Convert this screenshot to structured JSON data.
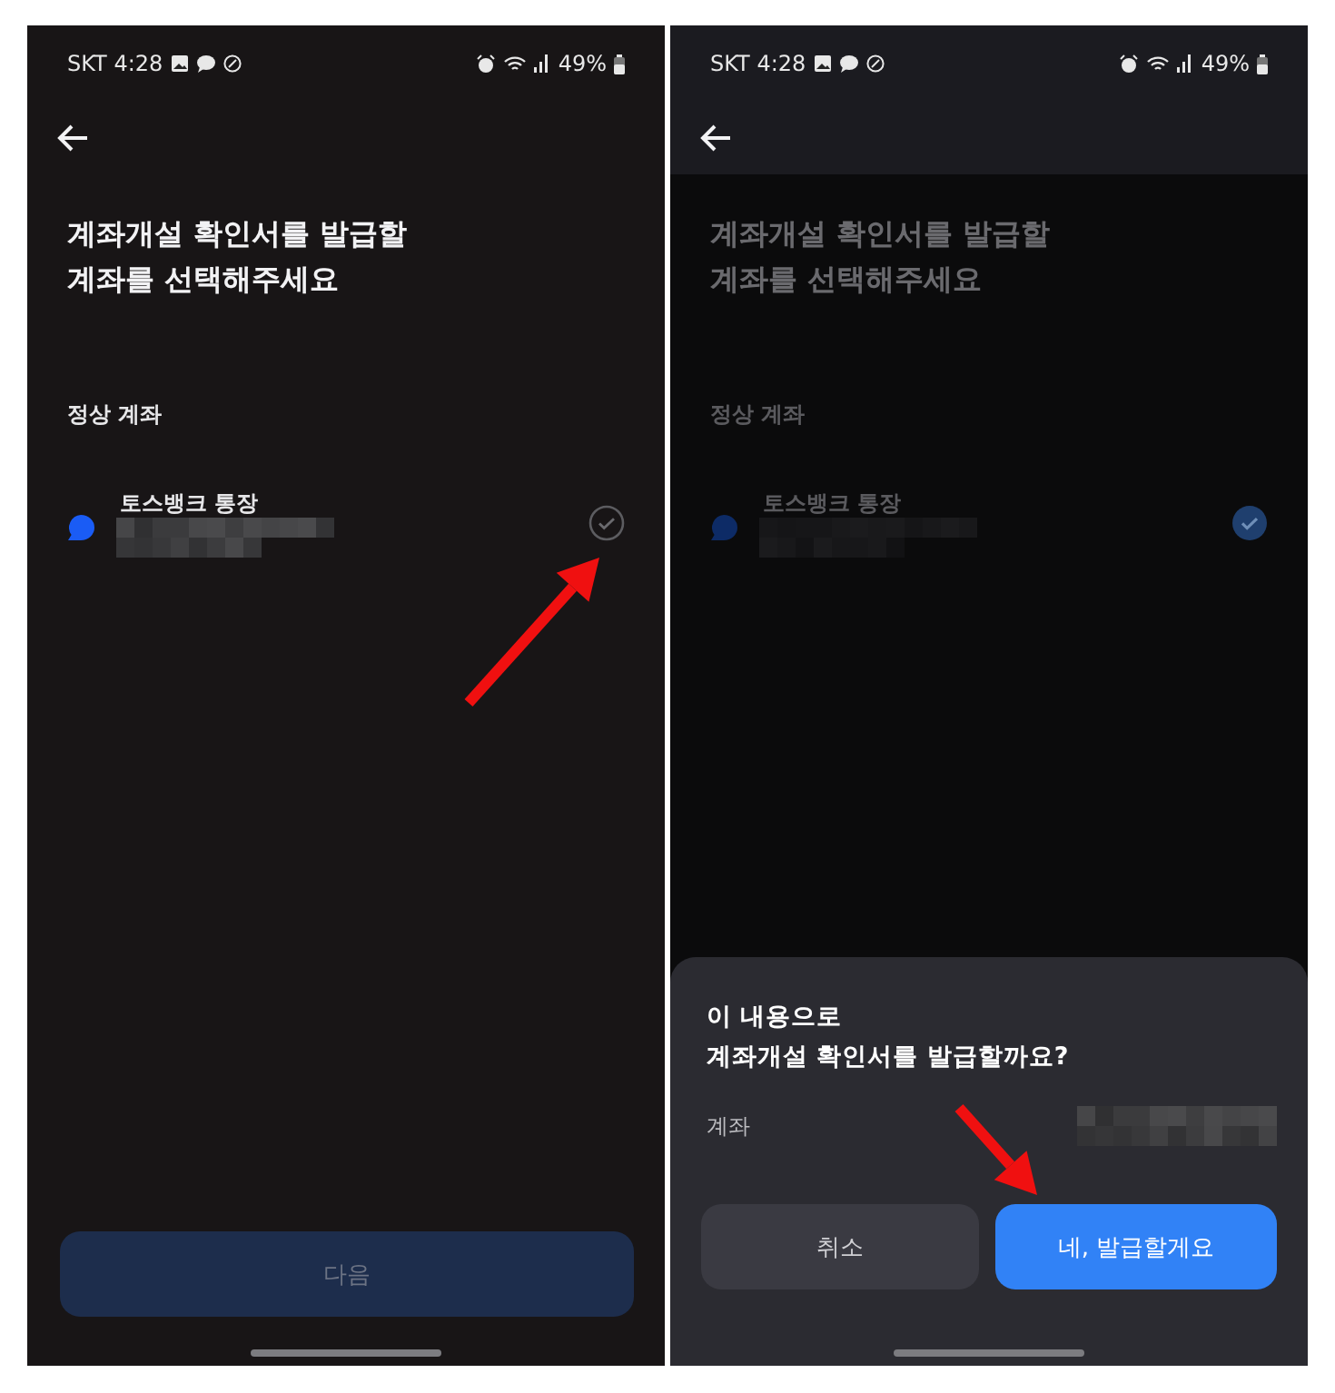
{
  "screens": [
    {
      "status_bar": {
        "carrier_time": "SKT 4:28",
        "battery": "49%"
      },
      "dimmed": false,
      "heading_lines": [
        "계좌개설 확인서를 발급할",
        "계좌를 선택해주세요"
      ],
      "section_label": "정상 계좌",
      "accounts": [
        {
          "name": "토스뱅크 통장",
          "selected": false
        }
      ],
      "next_button": {
        "label": "다음",
        "disabled": true
      }
    },
    {
      "status_bar": {
        "carrier_time": "SKT 4:28",
        "battery": "49%"
      },
      "dimmed": true,
      "heading_lines": [
        "계좌개설 확인서를 발급할",
        "계좌를 선택해주세요"
      ],
      "section_label": "정상 계좌",
      "accounts": [
        {
          "name": "토스뱅크 통장",
          "selected": true
        }
      ],
      "sheet": {
        "title_lines": [
          "이 내용으로",
          "계좌개설 확인서를 발급할까요?"
        ],
        "rows": [
          {
            "label": "계좌"
          }
        ],
        "buttons": [
          {
            "label": "취소",
            "kind": "secondary"
          },
          {
            "label": "네, 발급할게요",
            "kind": "primary"
          }
        ]
      }
    }
  ]
}
